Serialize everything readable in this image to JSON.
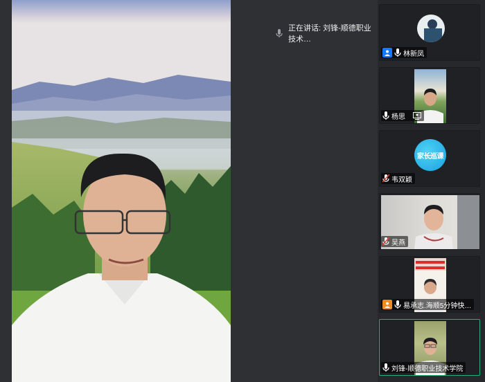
{
  "speaker_indicator": {
    "label": "正在讲话: 刘锋-顺德职业技术…",
    "icon": "microphone-icon"
  },
  "participants": [
    {
      "name": "林新凤",
      "badge": "user-avatar-icon",
      "badge_color": "#1677ff",
      "mic": "on",
      "has_video": true
    },
    {
      "name": "杨思",
      "badge": "",
      "mic": "on",
      "has_video": true,
      "screen_icon": true
    },
    {
      "name": "韦双颖",
      "badge": "",
      "mic": "muted",
      "has_video": false,
      "logo_text": "家长巡课"
    },
    {
      "name": "吴燕",
      "badge": "",
      "mic": "muted",
      "has_video": true
    },
    {
      "name": "易承志.海顺5分钟快…",
      "badge": "user-avatar-icon",
      "badge_color": "#f08a24",
      "mic": "on",
      "has_video": true
    },
    {
      "name": "刘锋-顺德职业技术学院",
      "badge": "",
      "mic": "on",
      "has_video": true,
      "active": true
    }
  ],
  "colors": {
    "active_border": "#1fb37a",
    "muted_mic": "#e0473a",
    "sidebar_bg": "#26282b",
    "stage_bg": "#2e3033"
  }
}
